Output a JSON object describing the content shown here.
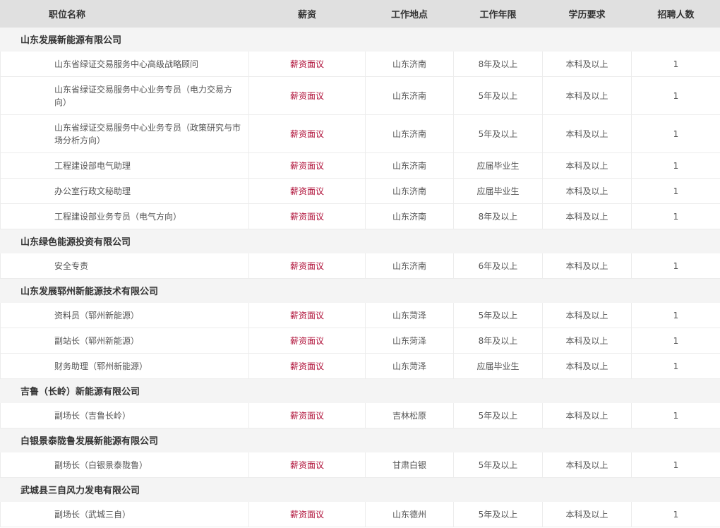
{
  "headers": [
    "职位名称",
    "薪资",
    "工作地点",
    "工作年限",
    "学历要求",
    "招聘人数"
  ],
  "groups": [
    {
      "name": "山东发展新能源有限公司",
      "jobs": [
        {
          "title": "山东省绿证交易服务中心高级战略顾问",
          "salary": "薪资面议",
          "location": "山东济南",
          "years": "8年及以上",
          "education": "本科及以上",
          "count": "1"
        },
        {
          "title": "山东省绿证交易服务中心业务专员（电力交易方向）",
          "salary": "薪资面议",
          "location": "山东济南",
          "years": "5年及以上",
          "education": "本科及以上",
          "count": "1"
        },
        {
          "title": "山东省绿证交易服务中心业务专员（政策研究与市场分析方向）",
          "salary": "薪资面议",
          "location": "山东济南",
          "years": "5年及以上",
          "education": "本科及以上",
          "count": "1"
        },
        {
          "title": "工程建设部电气助理",
          "salary": "薪资面议",
          "location": "山东济南",
          "years": "应届毕业生",
          "education": "本科及以上",
          "count": "1"
        },
        {
          "title": "办公室行政文秘助理",
          "salary": "薪资面议",
          "location": "山东济南",
          "years": "应届毕业生",
          "education": "本科及以上",
          "count": "1"
        },
        {
          "title": "工程建设部业务专员（电气方向）",
          "salary": "薪资面议",
          "location": "山东济南",
          "years": "8年及以上",
          "education": "本科及以上",
          "count": "1"
        }
      ]
    },
    {
      "name": "山东绿色能源投资有限公司",
      "jobs": [
        {
          "title": "安全专责",
          "salary": "薪资面议",
          "location": "山东济南",
          "years": "6年及以上",
          "education": "本科及以上",
          "count": "1"
        }
      ]
    },
    {
      "name": "山东发展郓州新能源技术有限公司",
      "jobs": [
        {
          "title": "资料员（郓州新能源）",
          "salary": "薪资面议",
          "location": "山东菏泽",
          "years": "5年及以上",
          "education": "本科及以上",
          "count": "1"
        },
        {
          "title": "副站长（郓州新能源）",
          "salary": "薪资面议",
          "location": "山东菏泽",
          "years": "8年及以上",
          "education": "本科及以上",
          "count": "1"
        },
        {
          "title": "财务助理（郓州新能源）",
          "salary": "薪资面议",
          "location": "山东菏泽",
          "years": "应届毕业生",
          "education": "本科及以上",
          "count": "1"
        }
      ]
    },
    {
      "name": "吉鲁（长岭）新能源有限公司",
      "jobs": [
        {
          "title": "副场长（吉鲁长岭）",
          "salary": "薪资面议",
          "location": "吉林松原",
          "years": "5年及以上",
          "education": "本科及以上",
          "count": "1"
        }
      ]
    },
    {
      "name": "白银景泰陇鲁发展新能源有限公司",
      "jobs": [
        {
          "title": "副场长（白银景泰陇鲁）",
          "salary": "薪资面议",
          "location": "甘肃白银",
          "years": "5年及以上",
          "education": "本科及以上",
          "count": "1"
        }
      ]
    },
    {
      "name": "武城县三自风力发电有限公司",
      "jobs": [
        {
          "title": "副场长（武城三自）",
          "salary": "薪资面议",
          "location": "山东德州",
          "years": "5年及以上",
          "education": "本科及以上",
          "count": "1"
        }
      ]
    }
  ]
}
